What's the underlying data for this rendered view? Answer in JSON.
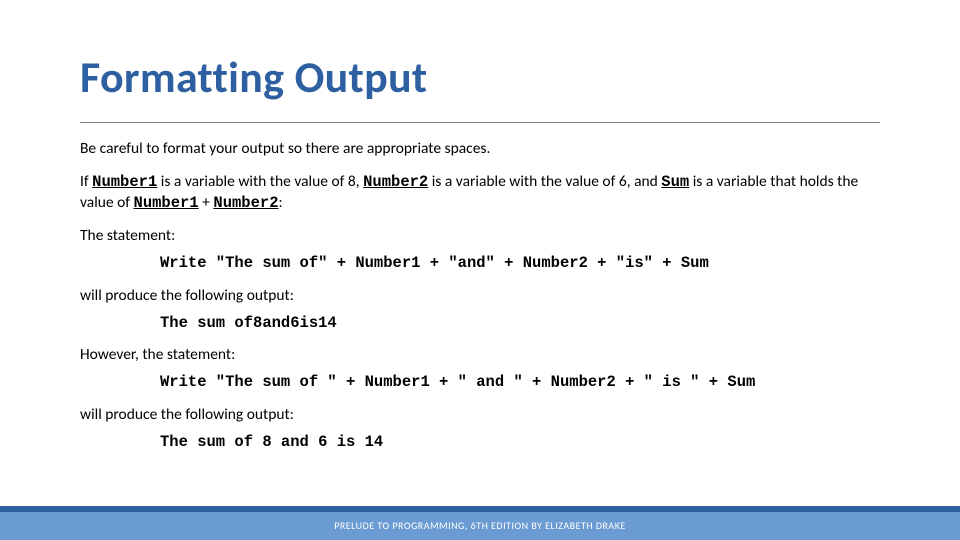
{
  "title": "Formatting Output",
  "intro": "Be careful to format your output so there are appropriate spaces.",
  "line2": {
    "p1": "If ",
    "v1": "Number1",
    "p2": " is a variable with the value of 8, ",
    "v2": "Number2",
    "p3": " is a variable with the value of 6, and ",
    "v3": "Sum",
    "p4": " is a variable that holds the value of ",
    "v4": "Number1",
    "p5": " + ",
    "v5": "Number2",
    "p6": ":"
  },
  "stmt_label": "The statement:",
  "code1": "Write \"The sum of\" + Number1 + \"and\" + Number2 + \"is\" + Sum",
  "produce_label": "will produce the following output:",
  "output1": "The sum of8and6is14",
  "however_label": "However, the statement:",
  "code2": "Write \"The sum of \" + Number1 + \" and \" + Number2 + \" is \" + Sum",
  "output2": "The sum of 8 and 6 is 14",
  "footer": "PRELUDE TO PROGRAMMING, 6TH EDITION BY ELIZABETH DRAKE"
}
